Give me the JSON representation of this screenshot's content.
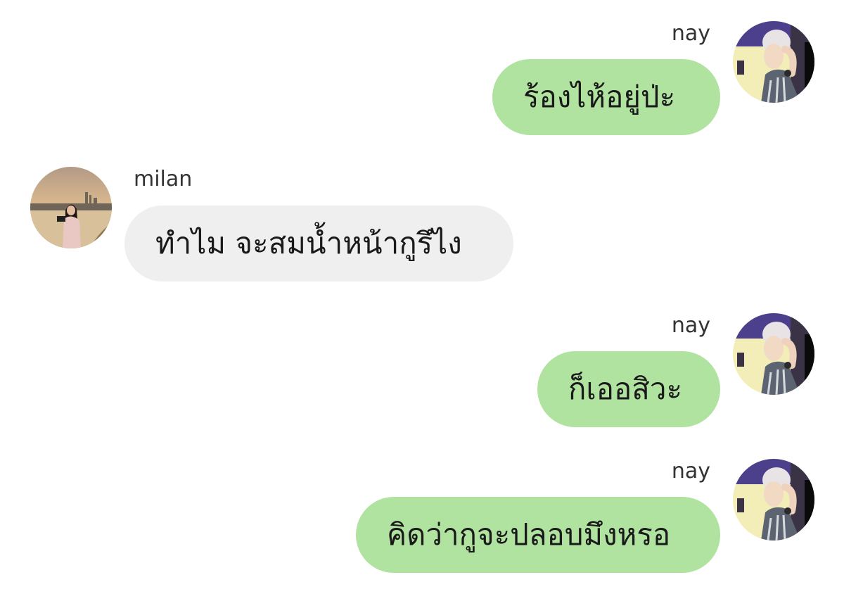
{
  "messages": [
    {
      "sender": "nay",
      "side": "right",
      "text": "ร้องไห้อยู่ป่ะ"
    },
    {
      "sender": "milan",
      "side": "left",
      "text": "ทำไม จะสมน้ำหน้ากูรึไง"
    },
    {
      "sender": "nay",
      "side": "right",
      "text": "ก็เออสิวะ"
    },
    {
      "sender": "nay",
      "side": "right",
      "text": "คิดว่ากูจะปลอบมึงหรอ"
    }
  ],
  "colors": {
    "outgoing_bubble": "#b0e2a0",
    "incoming_bubble": "#efefef",
    "background": "#ffffff"
  },
  "icons": {
    "nay_avatar": "user-avatar-photo",
    "milan_avatar": "user-avatar-photo"
  }
}
